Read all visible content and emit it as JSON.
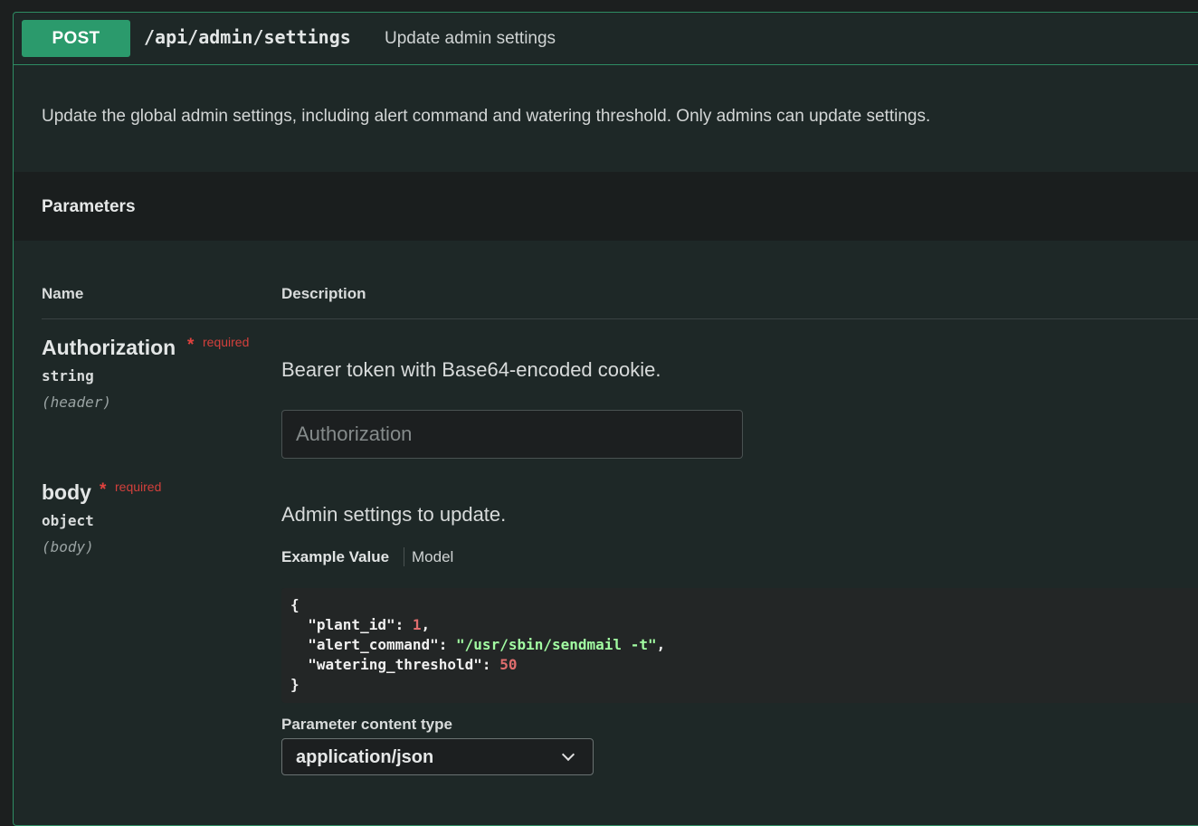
{
  "operation": {
    "method": "POST",
    "path": "/api/admin/settings",
    "summary": "Update admin settings",
    "description": "Update the global admin settings, including alert command and watering threshold. Only admins can update settings."
  },
  "parameters": {
    "title": "Parameters",
    "columns": {
      "name": "Name",
      "description": "Description"
    },
    "items": [
      {
        "name": "Authorization",
        "required_star": "*",
        "required_label": "required",
        "type": "string",
        "in": "(header)",
        "description": "Bearer token with Base64-encoded cookie.",
        "input_placeholder": "Authorization"
      },
      {
        "name": "body",
        "required_star": "*",
        "required_label": "required",
        "type": "object",
        "in": "(body)",
        "description": "Admin settings to update.",
        "tabs": {
          "example": "Example Value",
          "model": "Model"
        },
        "example": {
          "open": "{",
          "close": "}",
          "fields": [
            {
              "key": "\"plant_id\"",
              "value": "1",
              "kind": "num",
              "trail": ","
            },
            {
              "key": "\"alert_command\"",
              "value": "\"/usr/sbin/sendmail -t\"",
              "kind": "str",
              "trail": ","
            },
            {
              "key": "\"watering_threshold\"",
              "value": "50",
              "kind": "num",
              "trail": ""
            }
          ]
        },
        "content_type_label": "Parameter content type",
        "content_type_value": "application/json"
      }
    ]
  },
  "colors": {
    "post_green": "#2b9a6c",
    "required_red": "#d3403c",
    "string_green": "#a2fca2",
    "number_red": "#e06e6e"
  },
  "icons": {
    "select": "chevron-down-icon"
  }
}
